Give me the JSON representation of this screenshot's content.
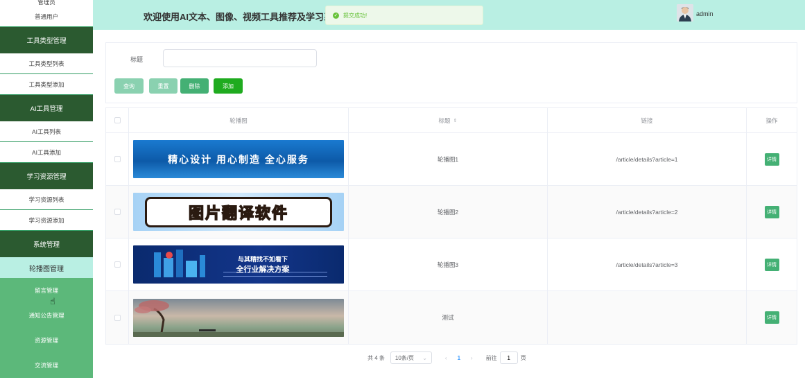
{
  "header": {
    "title": "欢迎使用AI文本、图像、视频工具推荐及学习系统",
    "toast": "提交成功!",
    "user": "admin"
  },
  "sidebar": {
    "top_label": "管理员",
    "user_item": "普通用户",
    "groups": [
      {
        "label": "工具类型管理",
        "items": [
          "工具类型列表",
          "工具类型添加"
        ]
      },
      {
        "label": "AI工具管理",
        "items": [
          "AI工具列表",
          "AI工具添加"
        ]
      },
      {
        "label": "学习资源管理",
        "items": [
          "学习资源列表",
          "学习资源添加"
        ]
      }
    ],
    "system": "系统管理",
    "active": "轮播图管理",
    "sub_items": [
      "留言管理",
      "通知公告管理",
      "资源管理",
      "交流管理"
    ]
  },
  "search": {
    "label": "标题",
    "value": "",
    "placeholder": ""
  },
  "buttons": {
    "query": "查询",
    "reset": "重置",
    "delete": "删除",
    "add": "添加"
  },
  "table": {
    "columns": [
      "轮播图",
      "标题",
      "链接",
      "操作"
    ],
    "sort_icon": "⇕",
    "detail_label": "详情",
    "rows": [
      {
        "banner_text": "精心设计  用心制造  全心服务",
        "title": "轮播图1",
        "link": "/article/details?article=1"
      },
      {
        "banner_text": "图片翻译软件",
        "title": "轮播图2",
        "link": "/article/details?article=2"
      },
      {
        "banner_text_1": "与其精找不如看下",
        "banner_text_2": "全行业解决方案",
        "title": "轮播图3",
        "link": "/article/details?article=3"
      },
      {
        "title": "测试",
        "link": ""
      }
    ]
  },
  "pagination": {
    "total": "共 4 条",
    "page_size": "10条/页",
    "current_page": "1",
    "goto_label": "前往",
    "goto_value": "1",
    "page_suffix": "页"
  },
  "colors": {
    "header_bg": "#b9efe3",
    "sidebar_group": "#2b5a30",
    "sidebar_green": "#5cb87a",
    "primary_btn": "#44b074",
    "add_btn": "#1fab1f"
  }
}
